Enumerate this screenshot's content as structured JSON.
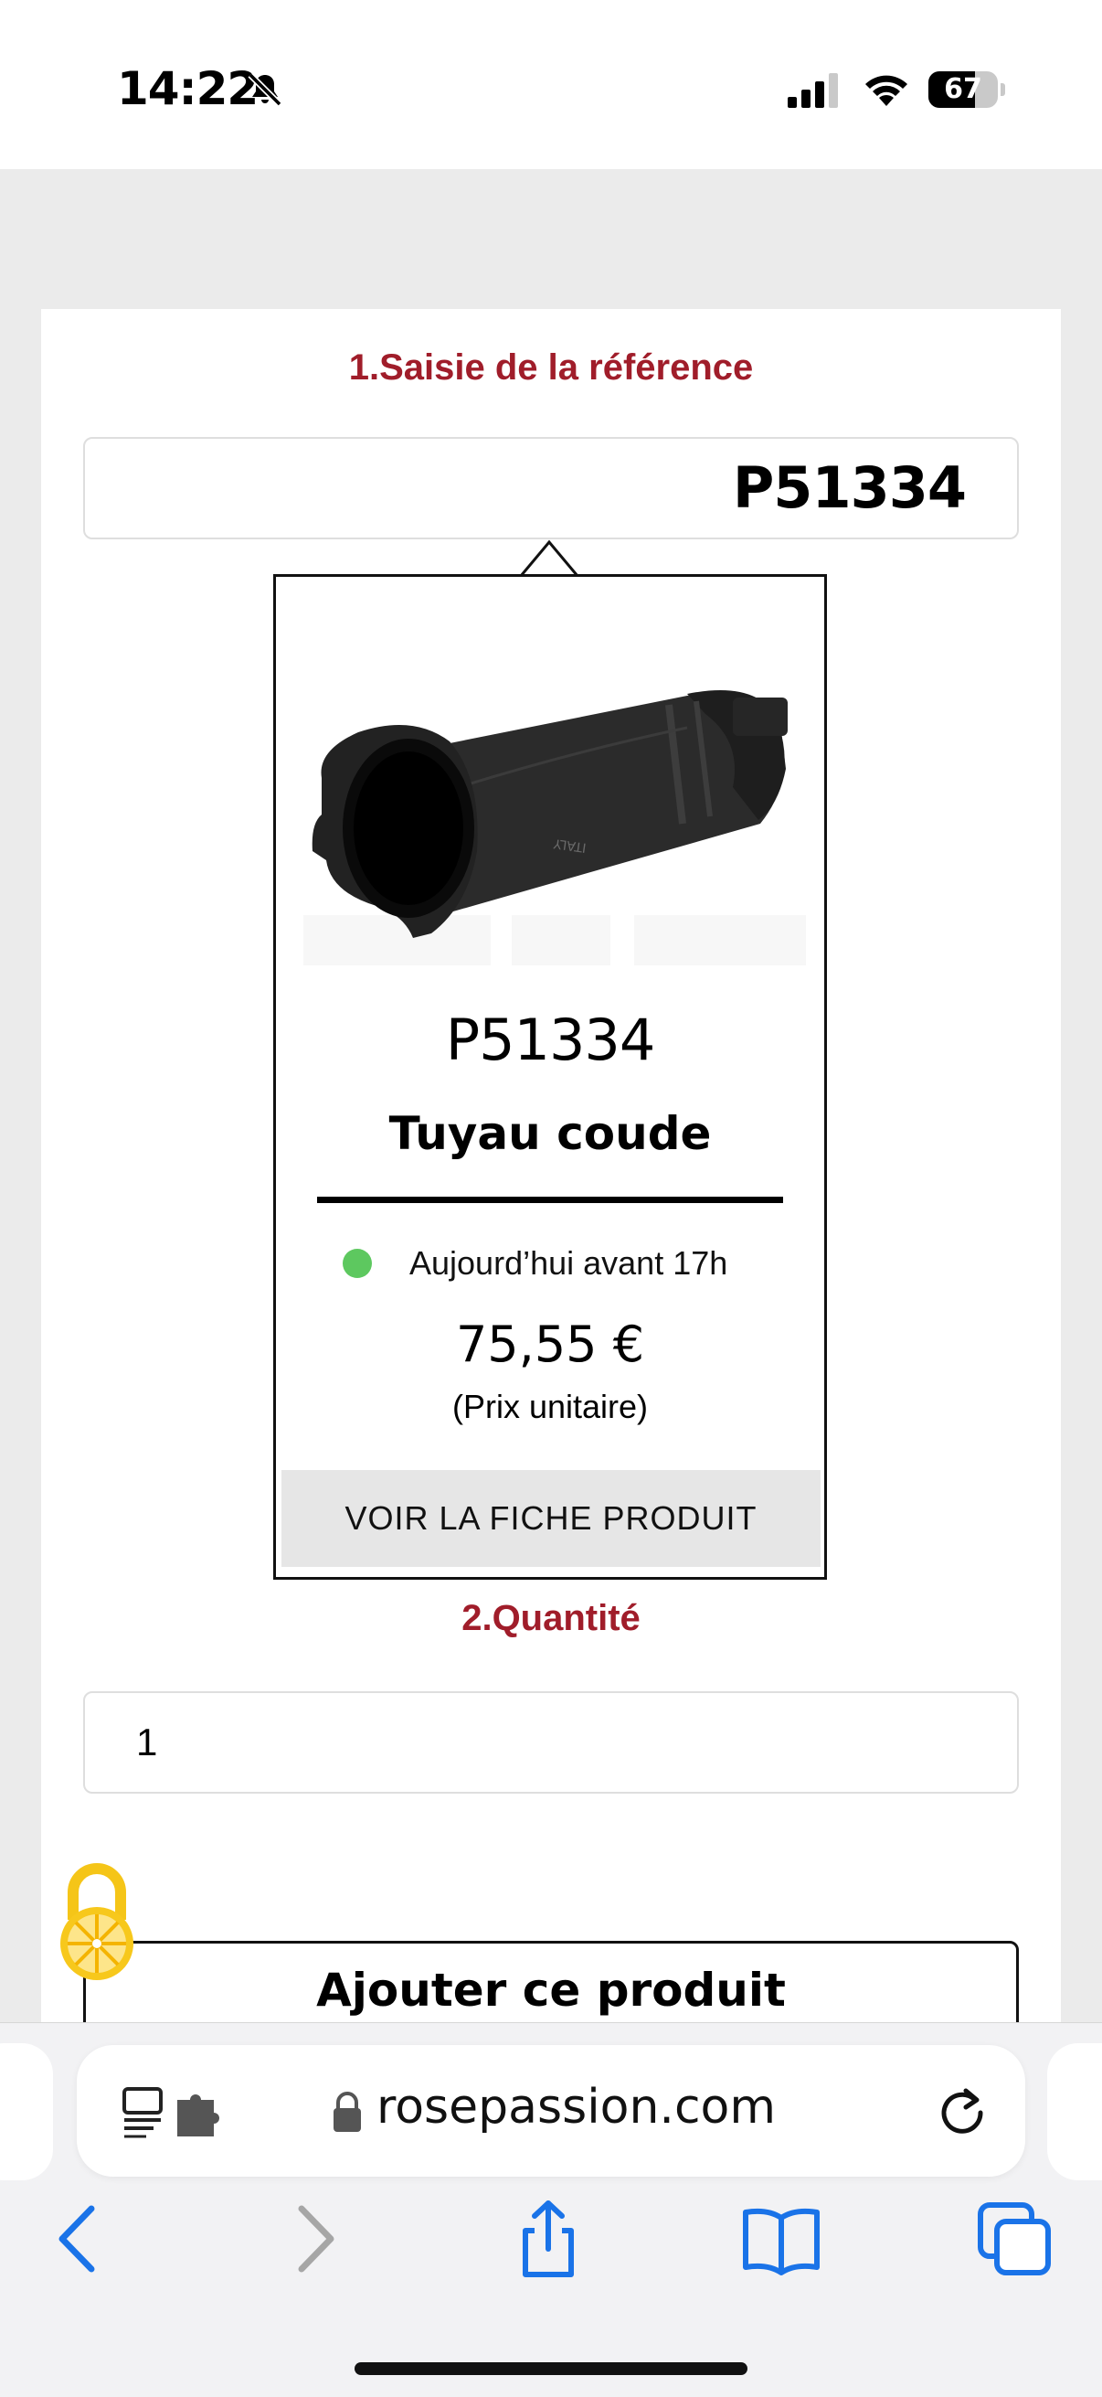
{
  "status_bar": {
    "time": "14:22",
    "battery": "67",
    "battery_level_percent": 67,
    "icons": [
      "bell-slash-icon",
      "signal-icon",
      "wifi-icon",
      "battery-icon"
    ]
  },
  "form": {
    "step1_title": "1.Saisie de la référence",
    "reference_value": "P51334",
    "step2_title": "2.Quantité",
    "quantity_value": "1",
    "add_button_label": "Ajouter ce produit"
  },
  "product_popup": {
    "reference": "P51334",
    "name": "Tuyau coude",
    "availability": "Aujourd’hui avant 17h",
    "availability_color": "#5dc85f",
    "price": "75,55 €",
    "price_note": "(Prix unitaire)",
    "button_label": "VOIR LA FICHE PRODUIT",
    "image_mark": "ITALY"
  },
  "browser": {
    "url": "rosepassion.com",
    "icons": [
      "reader-icon",
      "extension-icon",
      "lock-icon",
      "reload-icon"
    ]
  },
  "toolbar": {
    "icons": [
      "back-icon",
      "forward-icon",
      "share-icon",
      "bookmarks-icon",
      "tabs-icon"
    ]
  },
  "colors": {
    "accent": "#a01d2a",
    "ios_blue": "#1a73e8",
    "background": "#ebebeb"
  }
}
